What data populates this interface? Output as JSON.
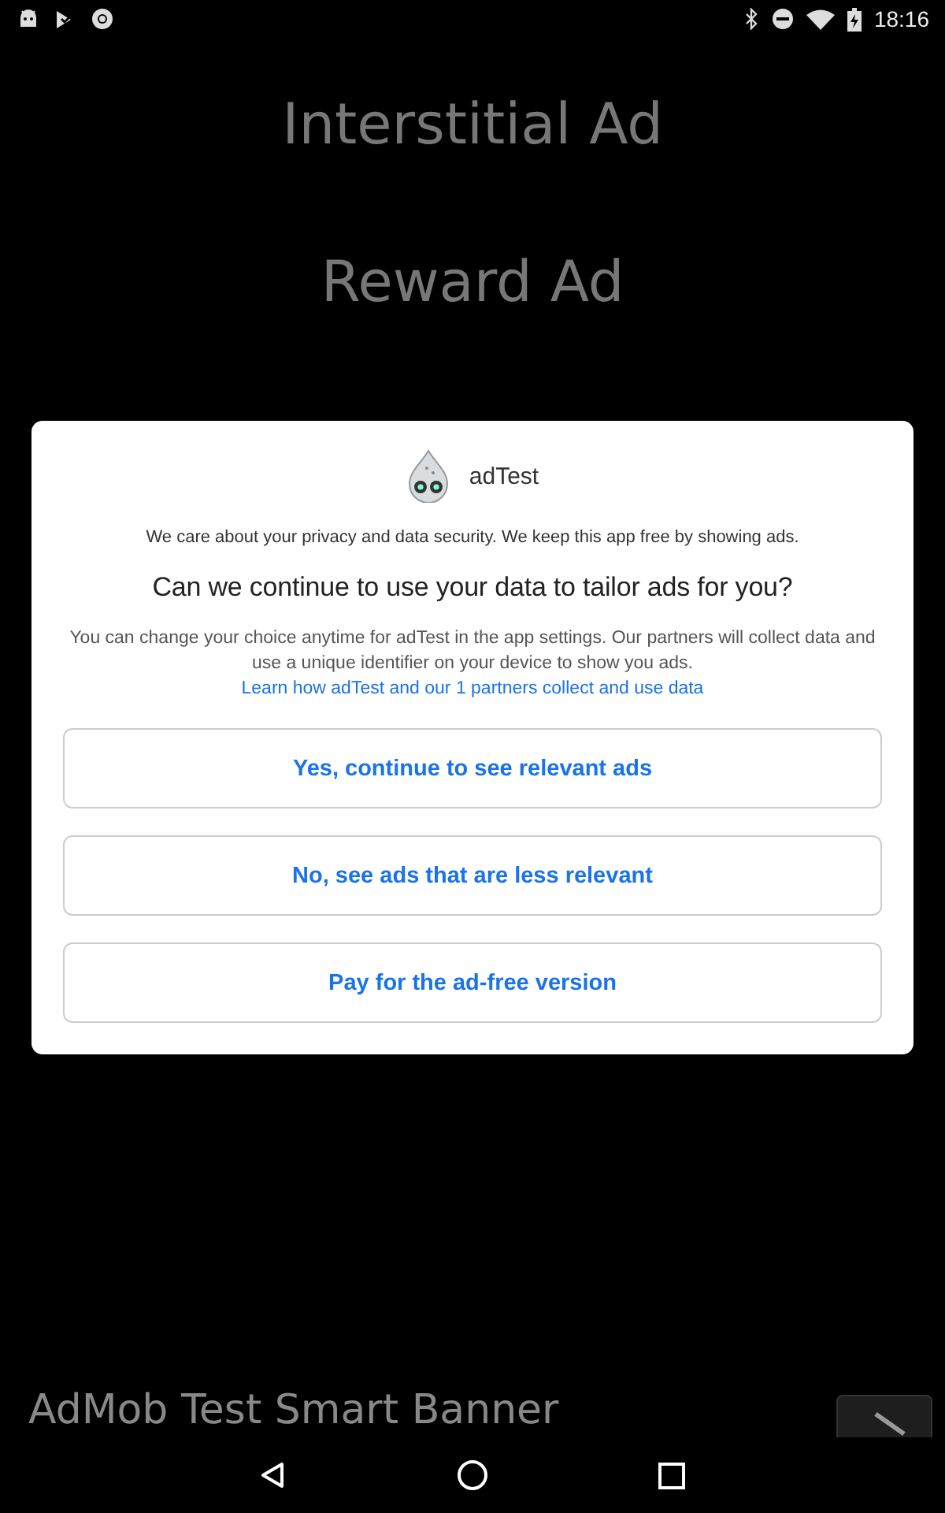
{
  "status_bar": {
    "time": "18:16"
  },
  "menu": [
    {
      "label": "Interstitial Ad"
    },
    {
      "label": "Reward Ad"
    }
  ],
  "dialog": {
    "app_name": "adTest",
    "intro": "We care about your privacy and data security. We keep this app free by showing ads.",
    "question": "Can we continue to use your data to tailor ads for you?",
    "body": "You can change your choice anytime for adTest in the app settings. Our partners will collect data and use a unique identifier on your device to show you ads.",
    "link": "Learn how adTest and our 1 partners collect and use data",
    "buttons": [
      {
        "label": "Yes, continue to see relevant ads"
      },
      {
        "label": "No, see ads that are less relevant"
      },
      {
        "label": "Pay for the ad-free version"
      }
    ]
  },
  "banner": {
    "label": "AdMob Test Smart Banner"
  }
}
